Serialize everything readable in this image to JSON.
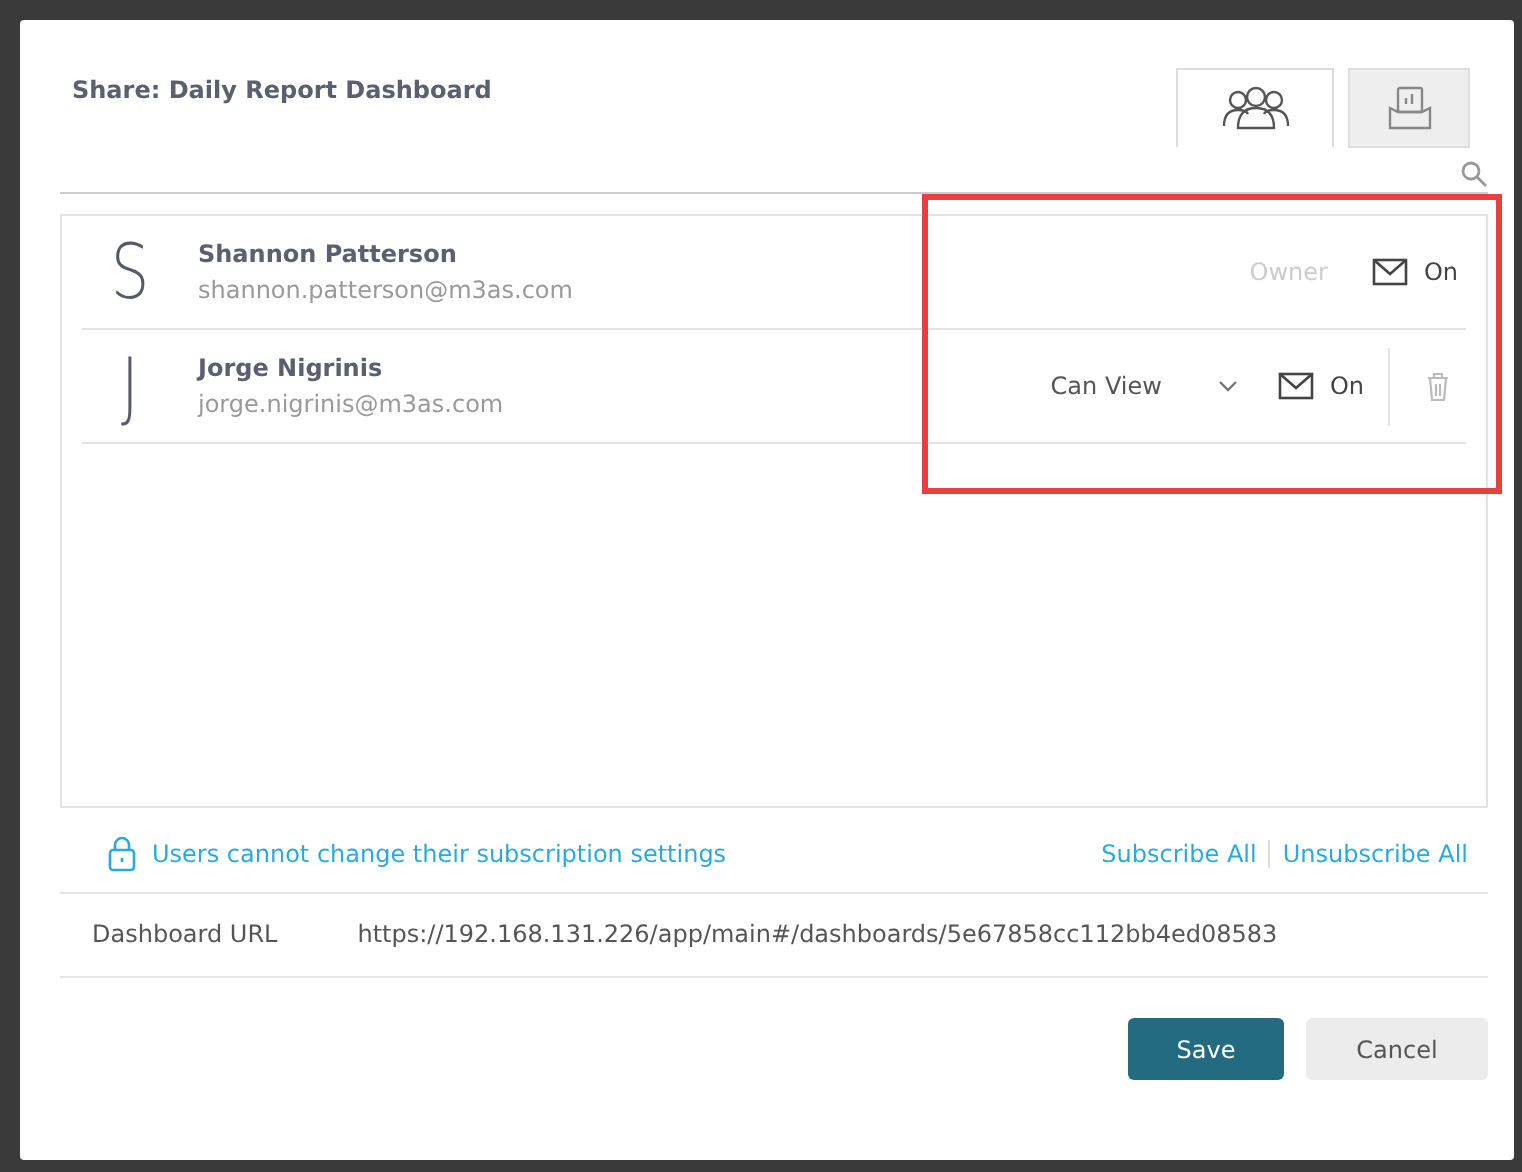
{
  "dialog": {
    "title": "Share:  Daily Report Dashboard"
  },
  "tabs": [
    {
      "kind": "users",
      "selected": true
    },
    {
      "kind": "report",
      "selected": false
    }
  ],
  "users": [
    {
      "initial": "S",
      "name": "Shannon Patterson",
      "email": "shannon.patterson@m3as.com",
      "role": "Owner",
      "editable": false,
      "notify": "On",
      "removable": false
    },
    {
      "initial": "J",
      "name": "Jorge Nigrinis",
      "email": "jorge.nigrinis@m3as.com",
      "role": "Can View",
      "editable": true,
      "notify": "On",
      "removable": true
    }
  ],
  "lock_note": "Users cannot change their subscription settings",
  "links": [
    "Subscribe All",
    "Unsubscribe All"
  ],
  "url": {
    "label": "Dashboard URL",
    "value": "https://192.168.131.226/app/main#/dashboards/5e67858cc112bb4ed08583"
  },
  "buttons": [
    {
      "label": "Save",
      "kind": "primary"
    },
    {
      "label": "Cancel",
      "kind": "secondary"
    }
  ]
}
